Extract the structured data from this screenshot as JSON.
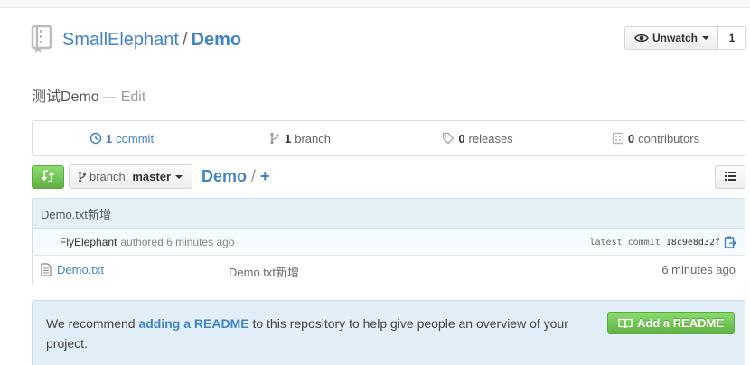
{
  "repo": {
    "owner": "SmallElephant",
    "separator": "/",
    "name": "Demo",
    "watch_label": "Unwatch",
    "watch_count": "1"
  },
  "description": {
    "text": "测试Demo",
    "dash": "—",
    "edit_label": "Edit"
  },
  "summary": {
    "commits": {
      "count": "1",
      "label": "commit"
    },
    "branches": {
      "count": "1",
      "label": "branch"
    },
    "releases": {
      "count": "0",
      "label": "releases"
    },
    "contributors": {
      "count": "0",
      "label": "contributors"
    }
  },
  "file_nav": {
    "branch_prefix": "branch:",
    "branch_name": "master",
    "breadcrumb_root": "Demo",
    "breadcrumb_slash": "/",
    "add_symbol": "+"
  },
  "latest_commit": {
    "message": "Demo.txt新增",
    "author": "FlyElephant",
    "authored": "authored 6 minutes ago",
    "label": "latest commit",
    "sha": "18c9e8d32f"
  },
  "files": [
    {
      "name": "Demo.txt",
      "message": "Demo.txt新增",
      "age": "6 minutes ago"
    }
  ],
  "readme": {
    "text_before": "We recommend",
    "link": "adding a README",
    "text_after": "to this repository to help give people an overview of your project.",
    "button_label": "Add a README"
  },
  "colors": {
    "link": "#4183c4",
    "green_button": "#60b044",
    "commit_header_bg": "#e6f1f6",
    "readme_bg": "#e3eff8"
  },
  "icons": [
    "repo-icon",
    "eye-icon",
    "history-icon",
    "branch-icon",
    "tag-icon",
    "organization-icon",
    "compare-icon",
    "list-icon",
    "clippy-icon",
    "file-icon",
    "book-icon"
  ]
}
